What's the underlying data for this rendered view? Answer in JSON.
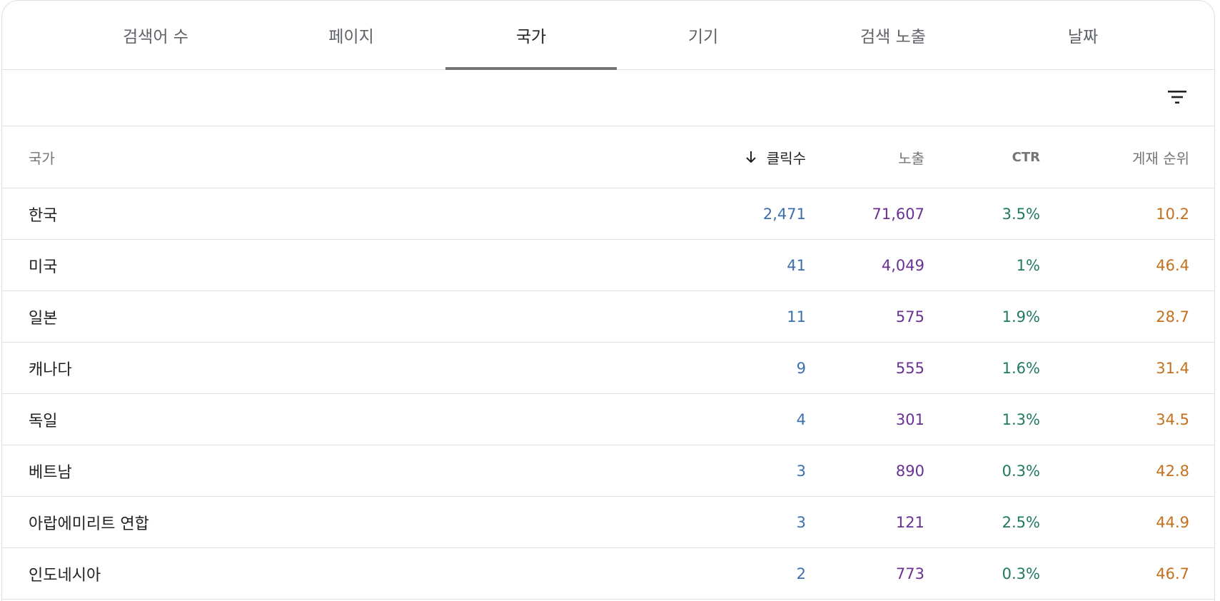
{
  "tabs": [
    {
      "label": "검색어 수",
      "active": false
    },
    {
      "label": "페이지",
      "active": false
    },
    {
      "label": "국가",
      "active": true
    },
    {
      "label": "기기",
      "active": false
    },
    {
      "label": "검색 노출",
      "active": false
    },
    {
      "label": "날짜",
      "active": false
    }
  ],
  "filter": {
    "icon": "filter-icon"
  },
  "table": {
    "headers": {
      "country": "국가",
      "clicks": "클릭수",
      "impressions": "노출",
      "ctr": "CTR",
      "position": "게재 순위"
    },
    "sort_icon": "arrow-down-icon",
    "rows": [
      {
        "country": "한국",
        "clicks": "2,471",
        "impressions": "71,607",
        "ctr": "3.5%",
        "position": "10.2"
      },
      {
        "country": "미국",
        "clicks": "41",
        "impressions": "4,049",
        "ctr": "1%",
        "position": "46.4"
      },
      {
        "country": "일본",
        "clicks": "11",
        "impressions": "575",
        "ctr": "1.9%",
        "position": "28.7"
      },
      {
        "country": "캐나다",
        "clicks": "9",
        "impressions": "555",
        "ctr": "1.6%",
        "position": "31.4"
      },
      {
        "country": "독일",
        "clicks": "4",
        "impressions": "301",
        "ctr": "1.3%",
        "position": "34.5"
      },
      {
        "country": "베트남",
        "clicks": "3",
        "impressions": "890",
        "ctr": "0.3%",
        "position": "42.8"
      },
      {
        "country": "아랍에미리트 연합",
        "clicks": "3",
        "impressions": "121",
        "ctr": "2.5%",
        "position": "44.9"
      },
      {
        "country": "인도네시아",
        "clicks": "2",
        "impressions": "773",
        "ctr": "0.3%",
        "position": "46.7"
      }
    ]
  },
  "colors": {
    "clicks": "#3c6fb0",
    "impressions": "#6a3195",
    "ctr": "#1f7a62",
    "position": "#c5701d",
    "tab_indicator": "#757575"
  }
}
